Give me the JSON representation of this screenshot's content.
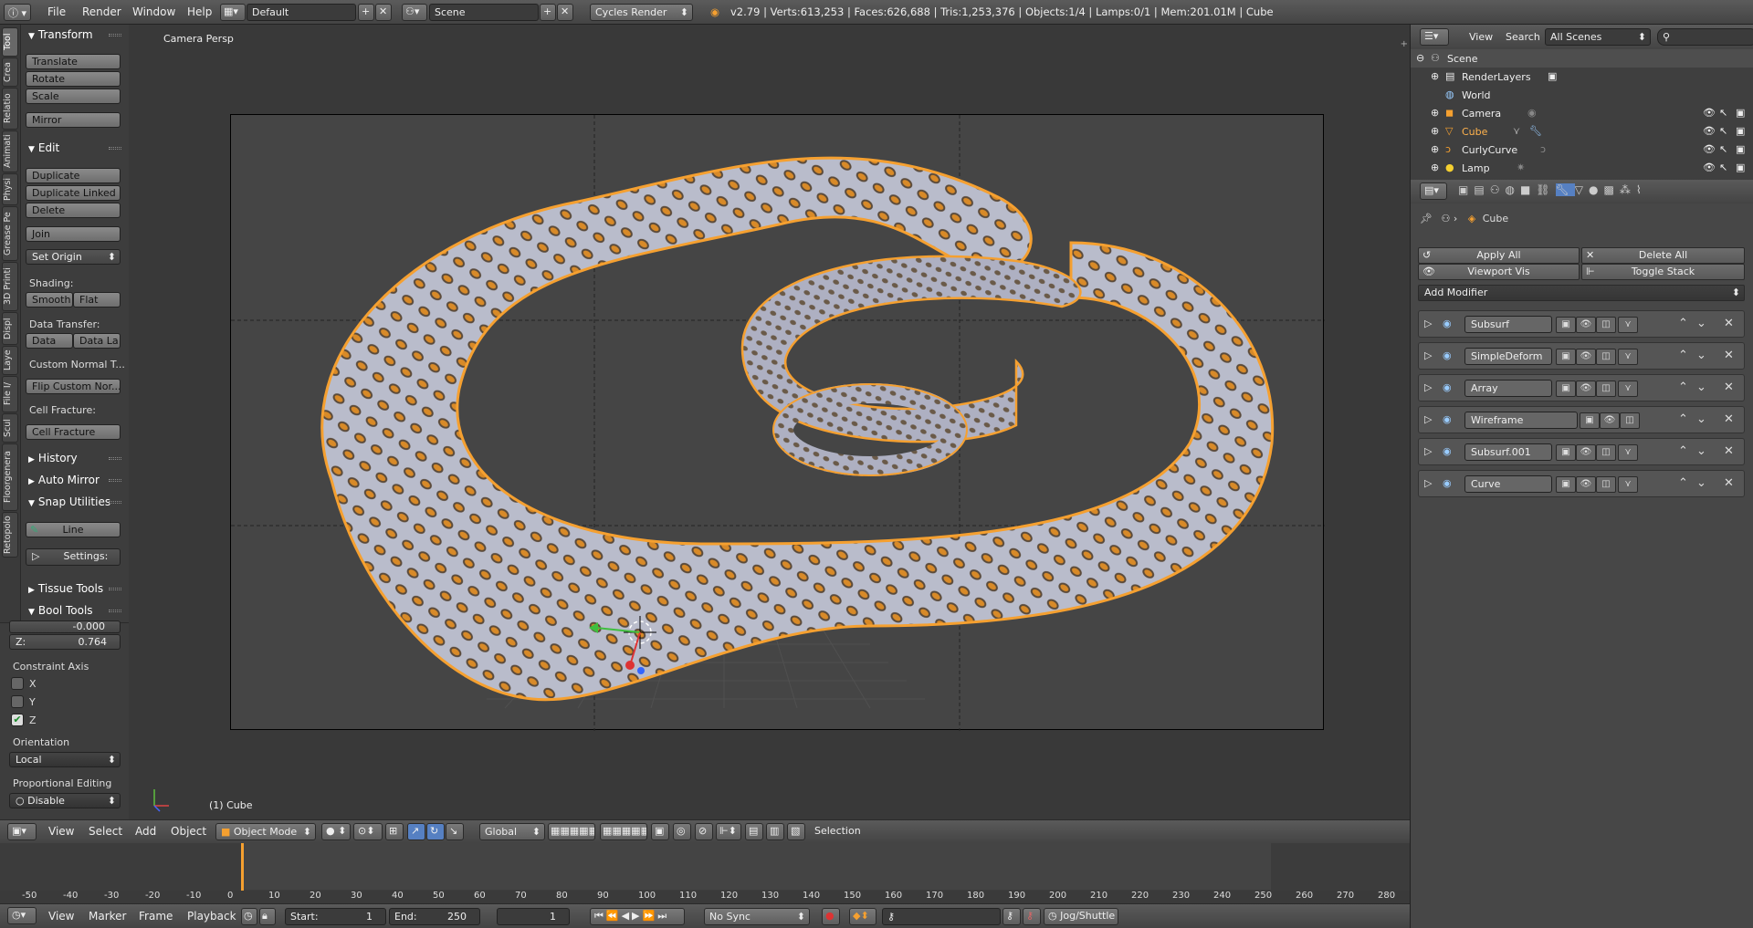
{
  "topbar": {
    "menus": [
      "File",
      "Render",
      "Window",
      "Help"
    ],
    "screen_layout": "Default",
    "scene": "Scene",
    "render_engine": "Cycles Render",
    "stats": "v2.79 | Verts:613,253 | Faces:626,688 | Tris:1,253,376 | Objects:1/4 | Lamps:0/1 | Mem:201.01M | Cube"
  },
  "tool_tabs": [
    "Tool",
    "Crea",
    "Relatio",
    "Animati",
    "Physi",
    "Grease Pe",
    "3D Printi",
    "Displ",
    "Laye",
    "File I/",
    "Scul",
    "Floorgenera",
    "Retopolo"
  ],
  "tool_panel": {
    "transform": {
      "title": "Transform",
      "buttons": [
        "Translate",
        "Rotate",
        "Scale",
        "Mirror"
      ]
    },
    "edit": {
      "title": "Edit",
      "buttons": [
        "Duplicate",
        "Duplicate Linked",
        "Delete",
        "Join"
      ],
      "set_origin": "Set Origin",
      "shading_label": "Shading:",
      "smooth": "Smooth",
      "flat": "Flat",
      "data_transfer_label": "Data Transfer:",
      "data": "Data",
      "data_la": "Data La",
      "custom_normal_label": "Custom Normal T...",
      "flip_custom": "Flip Custom Nor...",
      "cell_fracture_label": "Cell Fracture:",
      "cell_fracture": "Cell Fracture"
    },
    "history": "History",
    "auto_mirror": "Auto Mirror",
    "snap_utilities": {
      "title": "Snap Utilities",
      "line": "Line",
      "settings": "Settings:"
    },
    "tissue_tools": "Tissue Tools",
    "bool_tools": "Bool Tools"
  },
  "operator_panel": {
    "y_value": "-0.000",
    "z_label": "Z:",
    "z_value": "0.764",
    "constraint_axis": "Constraint Axis",
    "axes": [
      {
        "label": "X",
        "checked": false
      },
      {
        "label": "Y",
        "checked": false
      },
      {
        "label": "Z",
        "checked": true
      }
    ],
    "orientation_label": "Orientation",
    "orientation": "Local",
    "proportional_label": "Proportional Editing",
    "proportional": "Disable"
  },
  "viewport": {
    "view_name": "Camera Persp",
    "object_label": "(1) Cube"
  },
  "view3d_header": {
    "menus": [
      "View",
      "Select",
      "Add",
      "Object"
    ],
    "mode": "Object Mode",
    "orientation": "Global",
    "selection_label": "Selection"
  },
  "timeline": {
    "ruler": [
      "-50",
      "-40",
      "-30",
      "-20",
      "-10",
      "0",
      "10",
      "20",
      "30",
      "40",
      "50",
      "60",
      "70",
      "80",
      "90",
      "100",
      "110",
      "120",
      "130",
      "140",
      "150",
      "160",
      "170",
      "180",
      "190",
      "200",
      "210",
      "220",
      "230",
      "240",
      "250",
      "260",
      "270",
      "280"
    ],
    "current_frame_value": 0,
    "menus": [
      "View",
      "Marker",
      "Frame",
      "Playback"
    ],
    "start_label": "Start:",
    "start": "1",
    "end_label": "End:",
    "end": "250",
    "current": "1",
    "sync": "No Sync",
    "jog": "Jog/Shuttle"
  },
  "outliner": {
    "menus": [
      "View",
      "Search"
    ],
    "filter": "All Scenes",
    "items": [
      {
        "name": "Scene",
        "icon": "scene-icon"
      },
      {
        "name": "RenderLayers",
        "icon": "renderlayers-icon"
      },
      {
        "name": "World",
        "icon": "world-icon"
      },
      {
        "name": "Camera",
        "icon": "camera-icon"
      },
      {
        "name": "Cube",
        "icon": "mesh-icon"
      },
      {
        "name": "CurlyCurve",
        "icon": "curve-icon"
      },
      {
        "name": "Lamp",
        "icon": "lamp-icon"
      }
    ]
  },
  "properties": {
    "breadcrumb": "Cube",
    "apply_all": "Apply All",
    "delete_all": "Delete All",
    "viewport_vis": "Viewport Vis",
    "toggle_stack": "Toggle Stack",
    "add_modifier": "Add Modifier",
    "modifiers": [
      "Subsurf",
      "SimpleDeform",
      "Array",
      "Wireframe",
      "Subsurf.001",
      "Curve"
    ]
  },
  "colors": {
    "accent": "#f5a030",
    "selection": "#ff9f2e",
    "panel": "#3d3d3d"
  }
}
